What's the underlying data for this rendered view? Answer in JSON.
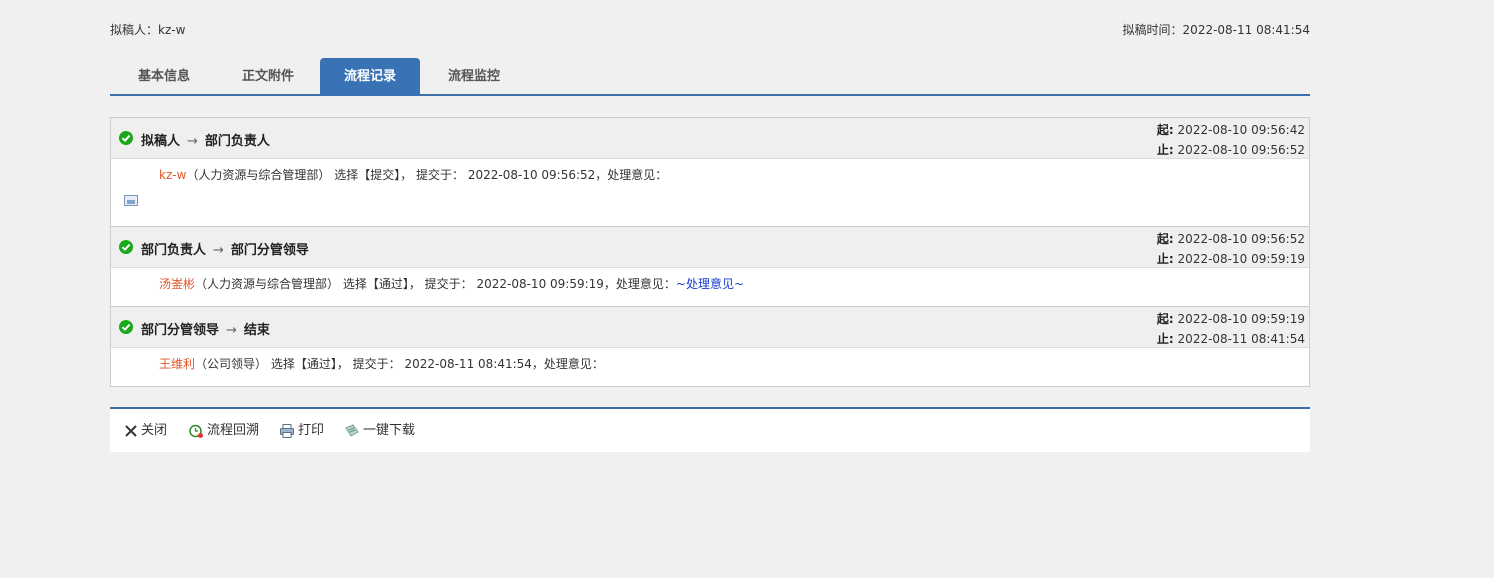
{
  "meta": {
    "drafter_label": "拟稿人：",
    "drafter": "kz-w",
    "draft_time_label": "拟稿时间：",
    "draft_time": "2022-08-11 08:41:54"
  },
  "tabs": [
    {
      "label": "基本信息",
      "active": false
    },
    {
      "label": "正文附件",
      "active": false
    },
    {
      "label": "流程记录",
      "active": true
    },
    {
      "label": "流程监控",
      "active": false
    }
  ],
  "records": [
    {
      "from": "拟稿人",
      "arrow": "→",
      "to": "部门负责人",
      "start_label": "起:",
      "start": "2022-08-10 09:56:42",
      "end_label": "止:",
      "end": "2022-08-10 09:56:52",
      "user": "kz-w",
      "detail": "（人力资源与综合管理部） 选择【提交】， 提交于： 2022-08-10 09:56:52，处理意见：",
      "opinion": ""
    },
    {
      "from": "部门负责人",
      "arrow": "→",
      "to": "部门分管领导",
      "start_label": "起:",
      "start": "2022-08-10 09:56:52",
      "end_label": "止:",
      "end": "2022-08-10 09:59:19",
      "user": "汤崟彬",
      "detail": "（人力资源与综合管理部） 选择【通过】， 提交于： 2022-08-10 09:59:19，处理意见：",
      "opinion": "~处理意见~"
    },
    {
      "from": "部门分管领导",
      "arrow": "→",
      "to": "结束",
      "start_label": "起:",
      "start": "2022-08-10 09:59:19",
      "end_label": "止:",
      "end": "2022-08-11 08:41:54",
      "user": "王维利",
      "detail": "（公司领导） 选择【通过】， 提交于： 2022-08-11 08:41:54，处理意见：",
      "opinion": ""
    }
  ],
  "toolbar": {
    "close": "关闭",
    "trace": "流程回溯",
    "print": "打印",
    "download": "一键下载"
  }
}
